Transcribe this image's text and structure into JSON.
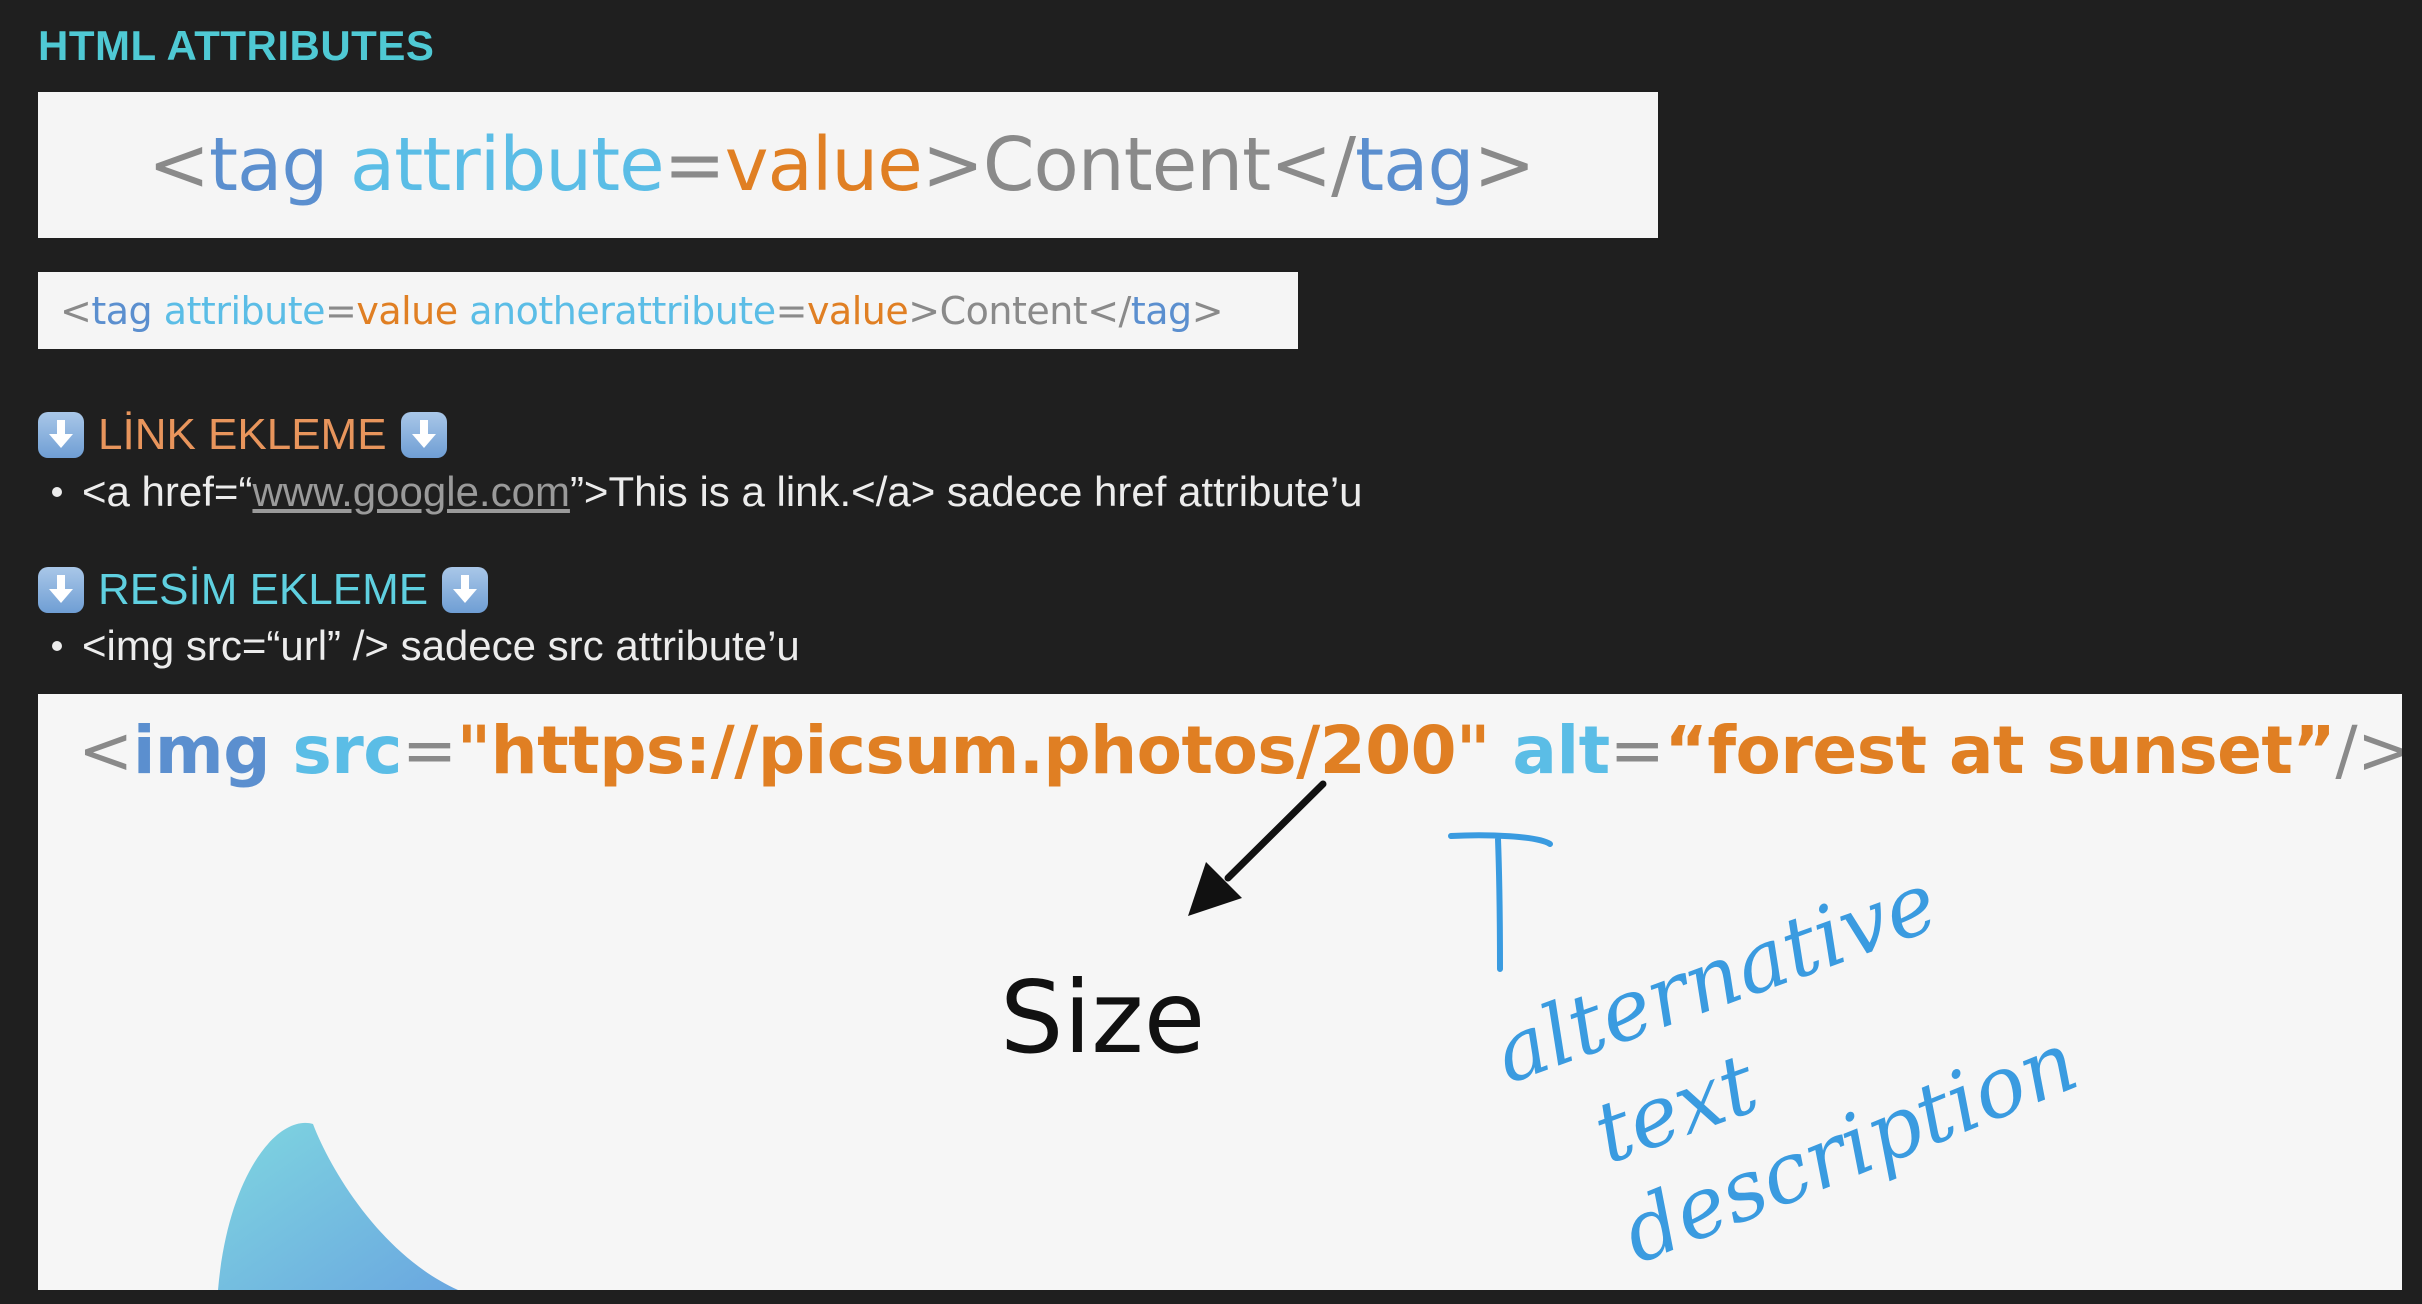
{
  "title": "HTML ATTRIBUTES",
  "box1": {
    "open": "<",
    "tag": "tag",
    "attr": "attribute",
    "eq": "=",
    "val": "value",
    "close_open": ">",
    "content": "Content",
    "end_open": "</",
    "end_tag": "tag",
    "end_close": ">"
  },
  "box2": {
    "open": "<",
    "tag": "tag",
    "attr1": "attribute",
    "eq1": "=",
    "val1": "value",
    "attr2": "anotherattribute",
    "eq2": "=",
    "val2": "value",
    "close_open": ">",
    "content": "Content",
    "end_open": "</",
    "end_tag": "tag",
    "end_close": ">"
  },
  "link_section": {
    "heading": "LİNK EKLEME",
    "bullet_prefix": "<a href=“",
    "bullet_link": "www.google.com",
    "bullet_suffix": "”>This is a link.</a> sadece href attribute’u"
  },
  "img_section": {
    "heading": "RESİM EKLEME",
    "bullet": "<img src=“url” /> sadece src attribute’u"
  },
  "big_code": {
    "open": "<",
    "tag": "img",
    "src_attr": "src",
    "eq1": "=",
    "src_val": "\"https://picsum.photos/200\"",
    "alt_attr": "alt",
    "eq2": "=",
    "alt_val": "“forest at sunset”",
    "close": "/>"
  },
  "annotations": {
    "size": "Size",
    "alt_line1": "alternative",
    "alt_line2": "text",
    "alt_line3": "description"
  },
  "colors": {
    "background": "#1f1f1f",
    "title": "#4fc9d4",
    "tag": "#5b8fcf",
    "attribute": "#5bbde6",
    "value": "#e07f23",
    "link_heading": "#e8955c",
    "img_heading": "#5fd0e0",
    "annotation_blue": "#3a9be0"
  },
  "icons": {
    "section_arrow": "down-arrow-icon"
  }
}
